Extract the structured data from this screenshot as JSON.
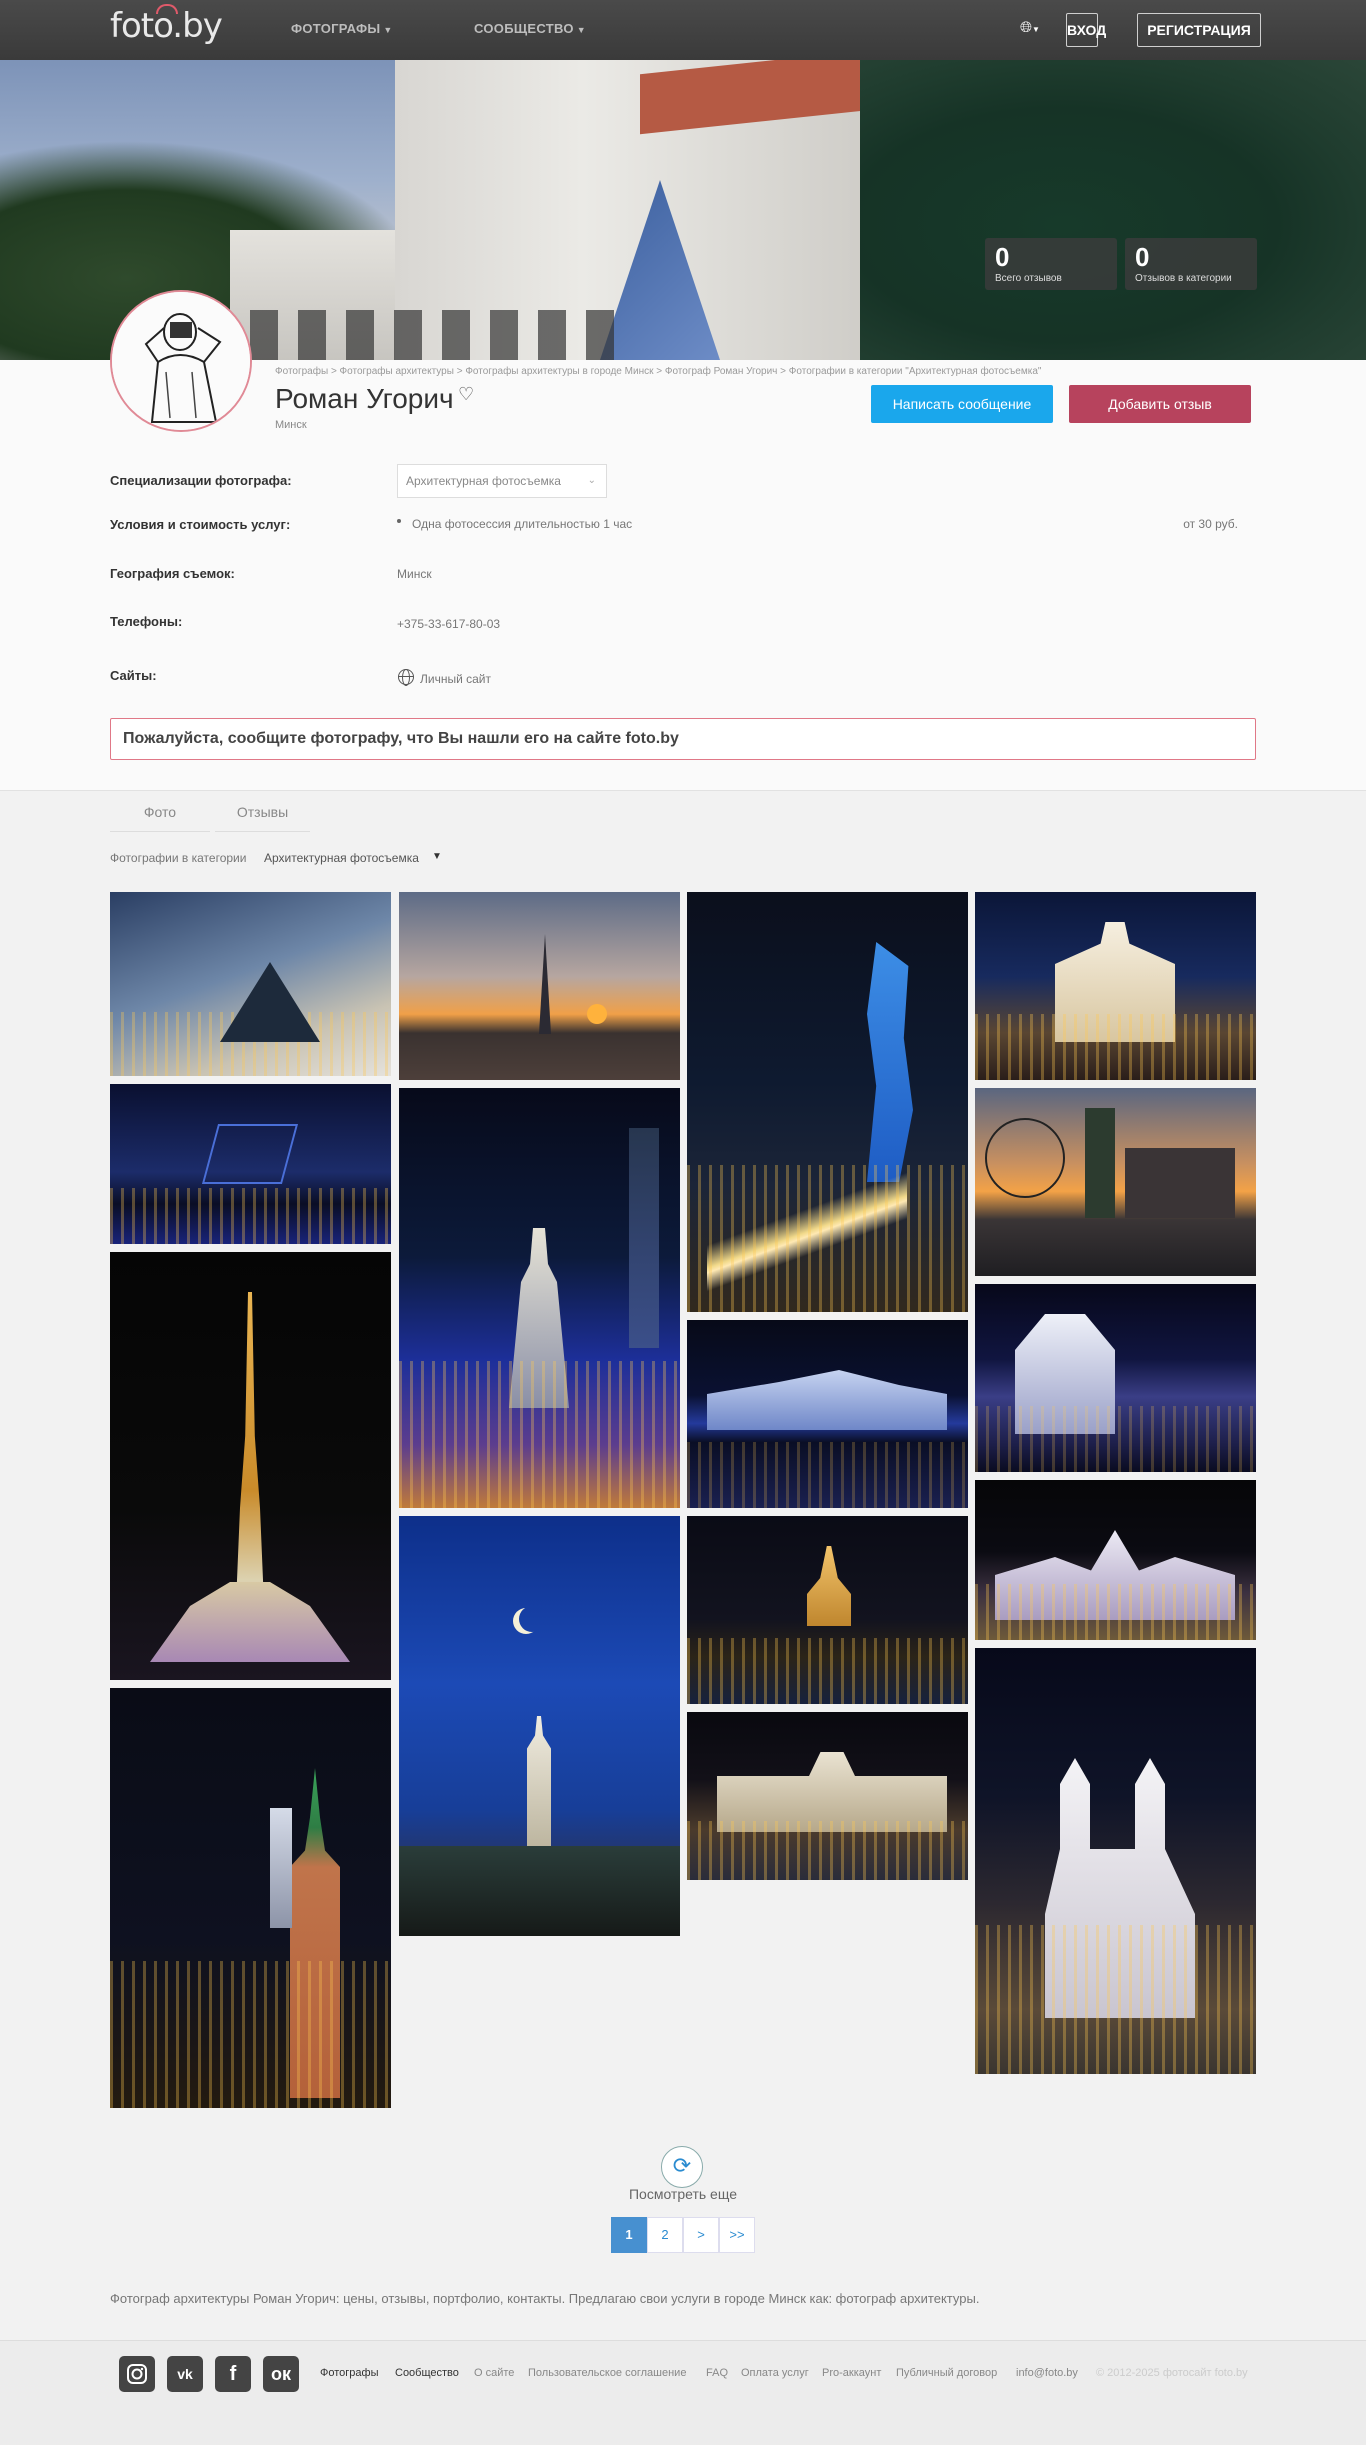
{
  "header": {
    "logo": "foto.by",
    "nav": [
      "ФОТОГРАФЫ",
      "СООБЩЕСТВО"
    ],
    "login": "ВХОД",
    "register": "РЕГИСТРАЦИЯ",
    "lang_icon": "globe-icon"
  },
  "stats": [
    {
      "value": "0",
      "label": "Всего отзывов"
    },
    {
      "value": "0",
      "label": "Отзывов в категории"
    }
  ],
  "profile": {
    "breadcrumb": "Фотографы > Фотографы архитектуры > Фотографы архитектуры в городе Минск > Фотограф Роман Угорич > Фотографии в категории \"Архитектурная фотосъемка\"",
    "name": "Роман Угорич",
    "city": "Минск",
    "write_message": "Написать сообщение",
    "add_review": "Добавить отзыв"
  },
  "info": {
    "spec_label": "Специализации фотографа:",
    "spec_value": "Архитектурная фотосъемка",
    "terms_label": "Условия и стоимость услуг:",
    "terms_item": "Одна фотосессия длительностью 1 час",
    "terms_price": "от 30 руб.",
    "geo_label": "География съемок:",
    "geo_value": "Минск",
    "phones_label": "Телефоны:",
    "phones_value": "+375-33-617-80-03",
    "sites_label": "Сайты:",
    "sites_value": "Личный сайт"
  },
  "notice": "Пожалуйста, сообщите фотографу, что Вы нашли его на сайте foto.by",
  "tabs": [
    "Фото",
    "Отзывы"
  ],
  "category": {
    "label": "Фотографии в категории",
    "value": "Архитектурная фотосъемка"
  },
  "load_more": "Посмотреть еще",
  "pagination": [
    "1",
    "2",
    ">",
    ">>"
  ],
  "seo_text": "Фотограф архитектуры Роман Угорич: цены, отзывы, портфолио, контакты. Предлагаю свои услуги в городе Минск как: фотограф архитектуры.",
  "footer": {
    "social": [
      "instagram-icon",
      "vk-icon",
      "facebook-icon",
      "odnoklassniki-icon"
    ],
    "links": [
      "Фотографы",
      "Сообщество",
      "О сайте",
      "Пользовательское соглашение",
      "FAQ",
      "Оплата услуг",
      "Pro-аккаунт",
      "Публичный договор",
      "info@foto.by"
    ],
    "copyright": "© 2012-2025 фотосайт foto.by"
  }
}
